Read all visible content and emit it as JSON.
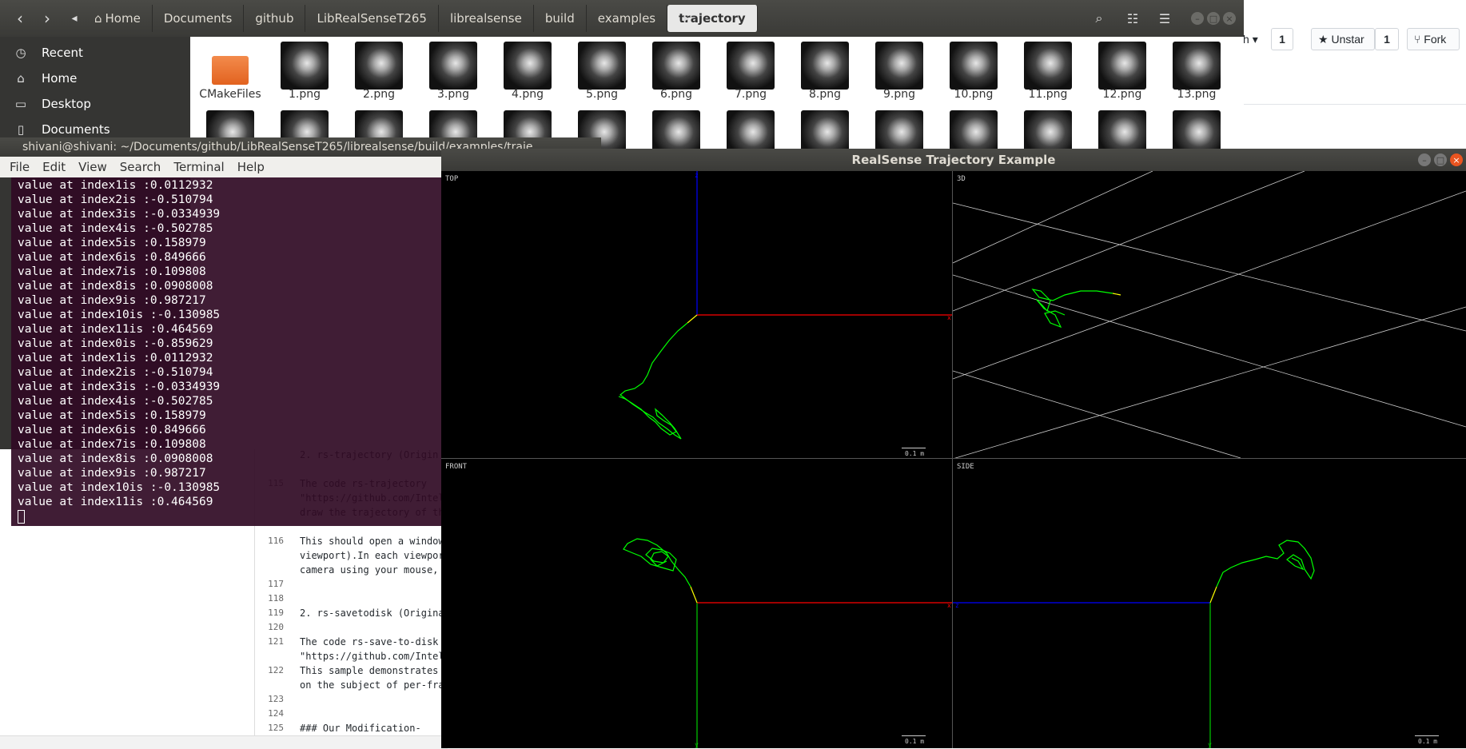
{
  "github": {
    "watch_partial": "ch",
    "watch_count": "1",
    "unstar_label": "Unstar",
    "star_count": "1",
    "fork_label": "Fork"
  },
  "editor": {
    "lines": [
      {
        "num": "",
        "text": "2. rs-trajectory (Origin"
      },
      {
        "num": "",
        "text": ""
      },
      {
        "num": "115",
        "text": "The code rs-trajectory"
      },
      {
        "num": "",
        "text": "\"https://github.com/Intel"
      },
      {
        "num": "",
        "text": "draw the trajectory of th"
      },
      {
        "num": "",
        "text": ""
      },
      {
        "num": "116",
        "text": "This should open a window"
      },
      {
        "num": "",
        "text": "viewport).In each viewpor"
      },
      {
        "num": "",
        "text": "camera using your mouse,"
      },
      {
        "num": "117",
        "text": ""
      },
      {
        "num": "118",
        "text": ""
      },
      {
        "num": "119",
        "text": "2. rs-savetodisk (Origina"
      },
      {
        "num": "120",
        "text": ""
      },
      {
        "num": "121",
        "text": "The code rs-save-to-disk"
      },
      {
        "num": "",
        "text": "\"https://github.com/Intel"
      },
      {
        "num": "122",
        "text": "This sample demonstrates"
      },
      {
        "num": "",
        "text": "on the subject of per-fra"
      },
      {
        "num": "123",
        "text": ""
      },
      {
        "num": "124",
        "text": ""
      },
      {
        "num": "125",
        "text": "### Our Modification-"
      }
    ]
  },
  "file_manager": {
    "breadcrumbs": [
      "Home",
      "Documents",
      "github",
      "LibRealSenseT265",
      "librealsense",
      "build",
      "examples",
      "trajectory"
    ],
    "sidebar": [
      {
        "icon": "clock-icon",
        "label": "Recent"
      },
      {
        "icon": "home-icon",
        "label": "Home"
      },
      {
        "icon": "folder-icon",
        "label": "Desktop"
      },
      {
        "icon": "document-icon",
        "label": "Documents"
      }
    ],
    "files": [
      "CMakeFiles",
      "1.png",
      "2.png",
      "3.png",
      "4.png",
      "5.png",
      "6.png",
      "7.png",
      "8.png",
      "9.png",
      "10.png",
      "11.png",
      "12.png",
      "13.png"
    ]
  },
  "terminal": {
    "title": "shivani@shivani: ~/Documents/github/LibRealSenseT265/librealsense/build/examples/traje",
    "menu": [
      "File",
      "Edit",
      "View",
      "Search",
      "Terminal",
      "Help"
    ],
    "lines": [
      "value at index1is :0.0112932",
      "value at index2is :-0.510794",
      "value at index3is :-0.0334939",
      "value at index4is :-0.502785",
      "value at index5is :0.158979",
      "value at index6is :0.849666",
      "value at index7is :0.109808",
      "value at index8is :0.0908008",
      "value at index9is :0.987217",
      "value at index10is :-0.130985",
      "value at index11is :0.464569",
      "value at index0is :-0.859629",
      "value at index1is :0.0112932",
      "value at index2is :-0.510794",
      "value at index3is :-0.0334939",
      "value at index4is :-0.502785",
      "value at index5is :0.158979",
      "value at index6is :0.849666",
      "value at index7is :0.109808",
      "value at index8is :0.0908008",
      "value at index9is :0.987217",
      "value at index10is :-0.130985",
      "value at index11is :0.464569"
    ]
  },
  "realsense": {
    "title": "RealSense Trajectory Example",
    "viewports": {
      "top": "TOP",
      "threed": "3D",
      "front": "FRONT",
      "side": "SIDE"
    },
    "scale_label": "0.1 m",
    "axis_x": "x",
    "axis_y": "y",
    "axis_z": "z",
    "colors": {
      "trajectory": "#00ff00",
      "recent": "#ffff00",
      "x_axis": "#ff0000",
      "y_axis": "#00cc00",
      "z_axis": "#0000ff",
      "grid": "#cccccc"
    }
  }
}
